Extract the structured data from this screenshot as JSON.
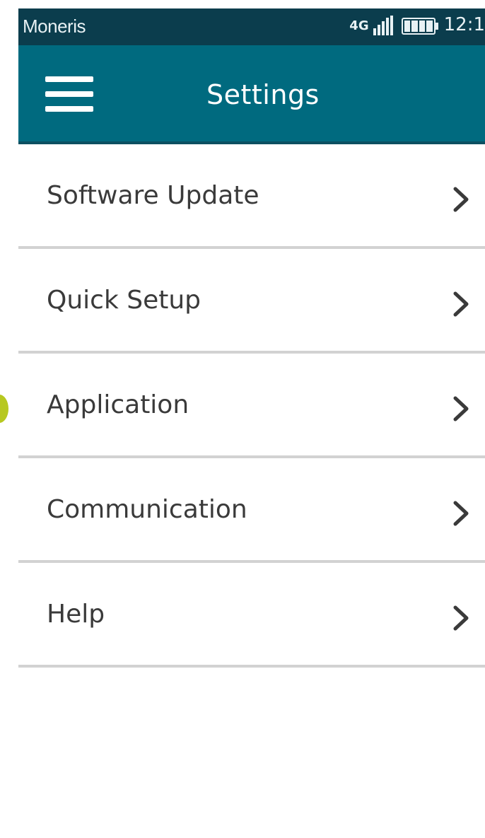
{
  "status_bar": {
    "carrier": "Moneris",
    "network": "4G",
    "time": "12:1",
    "signal_icon": "signal-bars-icon",
    "battery_icon": "battery-full-icon"
  },
  "app_bar": {
    "menu_icon": "hamburger-menu-icon",
    "title": "Settings"
  },
  "settings_items": [
    {
      "label": "Software Update",
      "icon": "chevron-right-icon"
    },
    {
      "label": "Quick Setup",
      "icon": "chevron-right-icon"
    },
    {
      "label": "Application",
      "icon": "chevron-right-icon"
    },
    {
      "label": "Communication",
      "icon": "chevron-right-icon"
    },
    {
      "label": "Help",
      "icon": "chevron-right-icon"
    }
  ],
  "colors": {
    "status_bar_bg": "#0b3d4d",
    "app_bar_bg": "#006a7f",
    "highlight_dot": "#b7c820",
    "divider": "#d2d2d2"
  }
}
